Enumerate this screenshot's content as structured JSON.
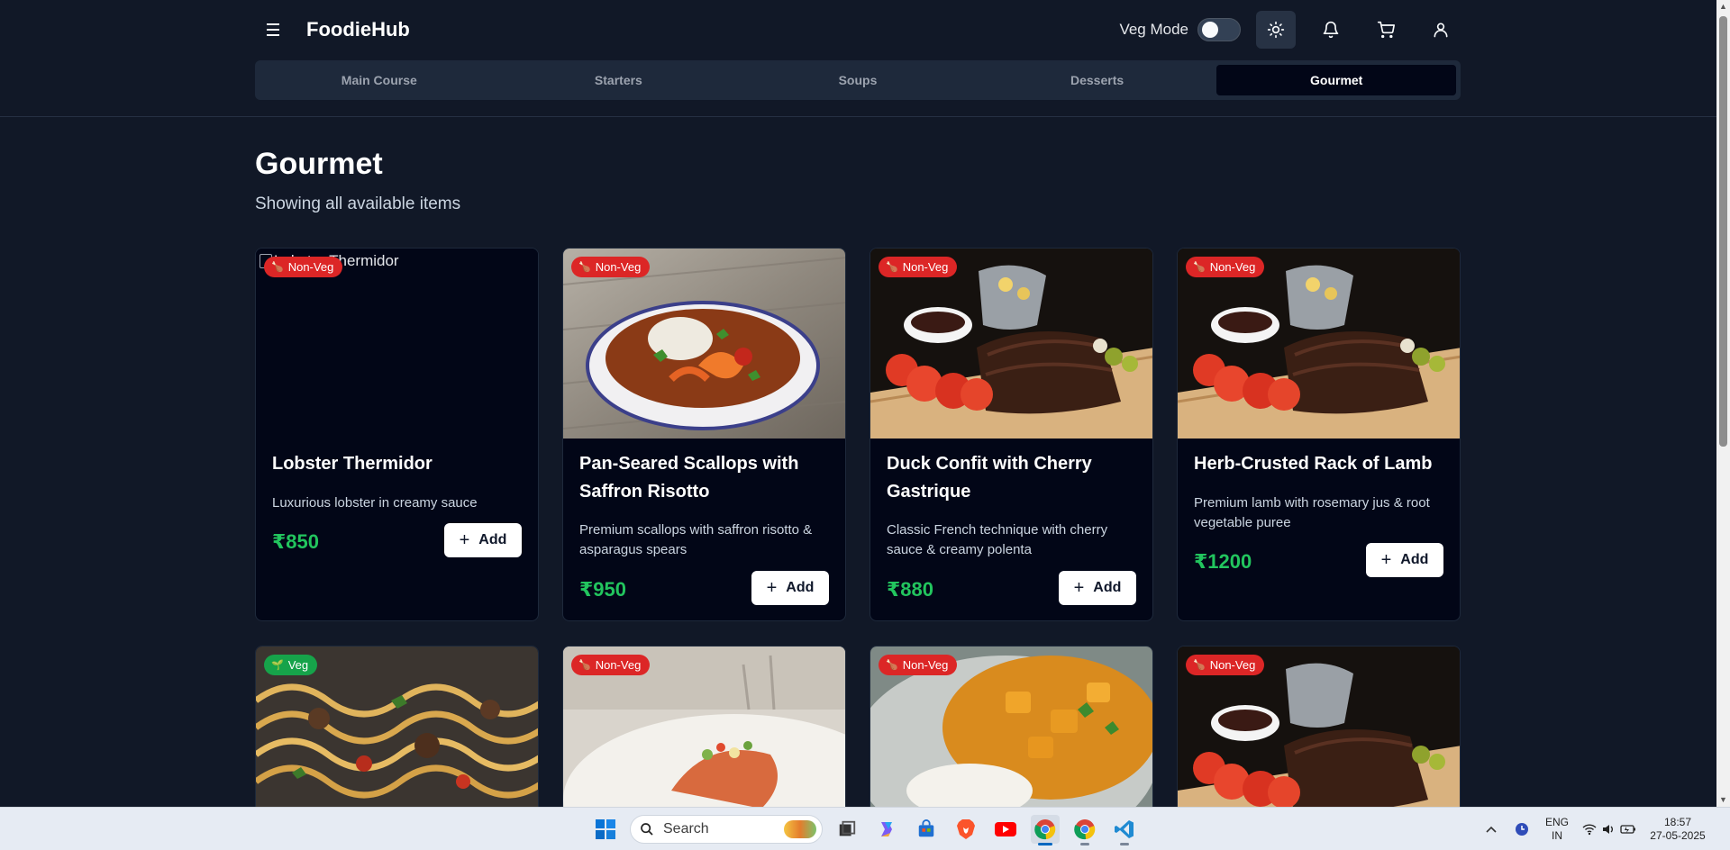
{
  "header": {
    "brand": "FoodieHub",
    "veg_mode_label": "Veg Mode",
    "veg_mode_on": false
  },
  "tabs": [
    {
      "label": "Main Course",
      "active": false
    },
    {
      "label": "Starters",
      "active": false
    },
    {
      "label": "Soups",
      "active": false
    },
    {
      "label": "Desserts",
      "active": false
    },
    {
      "label": "Gourmet",
      "active": true
    }
  ],
  "main": {
    "title": "Gourmet",
    "subtitle": "Showing all available items",
    "add_label": "Add",
    "items": [
      {
        "name": "Lobster Thermidor",
        "description": "Luxurious lobster in creamy sauce",
        "price": "₹850",
        "badge": "Non-Veg",
        "image_alt": "Lobster Thermidor",
        "image": "broken"
      },
      {
        "name": "Pan-Seared Scallops with Saffron Risotto",
        "description": "Premium scallops with saffron risotto & asparagus spears",
        "price": "₹950",
        "badge": "Non-Veg",
        "image": "curry-bowl"
      },
      {
        "name": "Duck Confit with Cherry Gastrique",
        "description": "Classic French technique with cherry sauce & creamy polenta",
        "price": "₹880",
        "badge": "Non-Veg",
        "image": "ribs-board"
      },
      {
        "name": "Herb-Crusted Rack of Lamb",
        "description": "Premium lamb with rosemary jus & root vegetable puree",
        "price": "₹1200",
        "badge": "Non-Veg",
        "image": "ribs-board"
      },
      {
        "badge": "Veg",
        "image": "pasta"
      },
      {
        "badge": "Non-Veg",
        "image": "salmon-plate"
      },
      {
        "badge": "Non-Veg",
        "image": "paneer-curry"
      },
      {
        "badge": "Non-Veg",
        "image": "ribs-board"
      }
    ]
  },
  "taskbar": {
    "search_placeholder": "Search",
    "lang_line1": "ENG",
    "lang_line2": "IN",
    "time": "18:57",
    "date": "27-05-2025"
  }
}
